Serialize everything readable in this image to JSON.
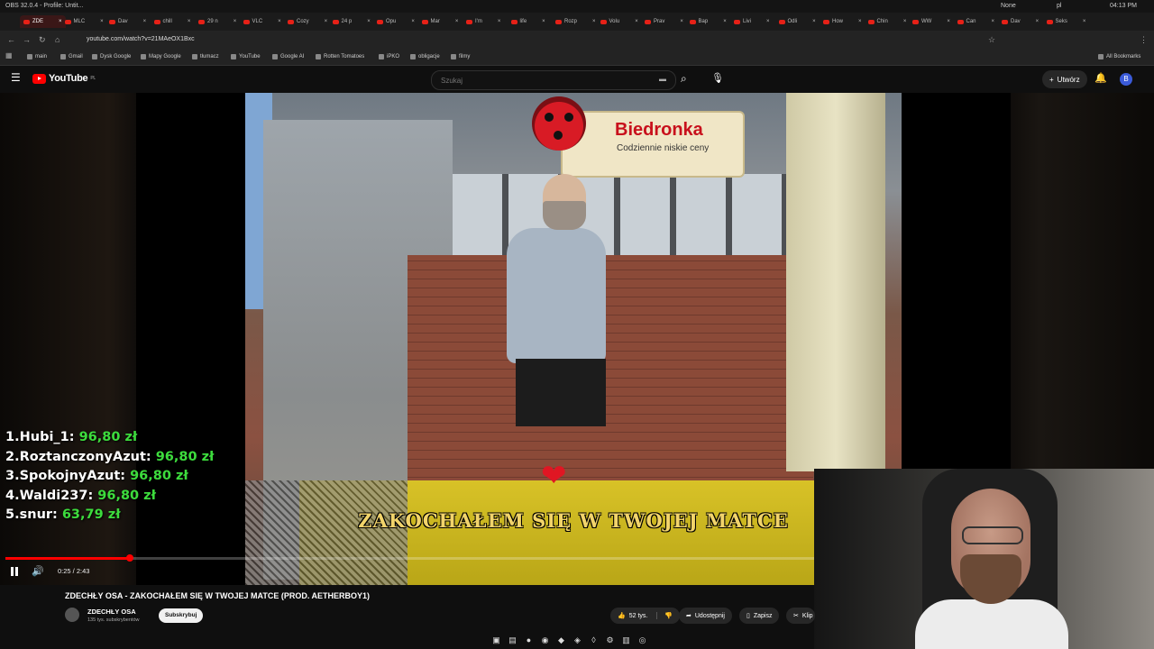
{
  "os_bar": {
    "app": "OBS 32.0.4 - Profile: Untit...",
    "profile": "None",
    "lang": "pl",
    "time": "04:13 PM"
  },
  "browser": {
    "tabs": [
      "ZDE",
      "MLC",
      "Dav",
      "chill",
      "29 n",
      "VLC",
      "Cozy",
      "24 p",
      "Opu",
      "Mar",
      "I'm",
      "life",
      "Rozp",
      "Volu",
      "Prav",
      "Bap",
      "Livi",
      "Odli",
      "How",
      "Chin",
      "WW",
      "Can",
      "Dav",
      "Seks"
    ],
    "url": "youtube.com/watch?v=21MAeOX1Bxc",
    "bookmarks": [
      "main",
      "Gmail",
      "Dysk Google",
      "Mapy Google",
      "tłumacz",
      "YouTube",
      "Google AI",
      "Rotten Tomatoes",
      "iPKO",
      "obligacje",
      "filmy"
    ],
    "all_bookmarks": "All Bookmarks"
  },
  "youtube": {
    "logo_text": "YouTube",
    "logo_region": "PL",
    "search_placeholder": "Szukaj",
    "create_label": "Utwórz",
    "avatar_letter": "B"
  },
  "video": {
    "sign_name": "Biedronka",
    "sign_tagline": "Codziennie niskie ceny",
    "lyric": "ZAKOCHAŁEM SIĘ W TWOJEJ MATCE",
    "heart": "❤",
    "time": "0:25 / 2:43",
    "progress": 0.154
  },
  "donors": [
    {
      "rank": "1.",
      "name": "Hubi_1:",
      "amount": "96,80 zł"
    },
    {
      "rank": "2.",
      "name": "RoztanczonyAzut:",
      "amount": "96,80 zł"
    },
    {
      "rank": "3.",
      "name": "SpokojnyAzut:",
      "amount": "96,80 zł"
    },
    {
      "rank": "4.",
      "name": "Waldi237:",
      "amount": "96,80 zł"
    },
    {
      "rank": "5.",
      "name": "snur:",
      "amount": "63,79 zł"
    }
  ],
  "meta": {
    "title": "ZDECHŁY OSA - ZAKOCHAŁEM SIĘ W TWOJEJ MATCE (PROD. AETHERBOY1)",
    "channel": "ZDECHŁY OSA",
    "subscribers": "135 tys. subskrybentów",
    "subscribe_label": "Subskrybuj",
    "likes": "52 tys.",
    "share_label": "Udostępnij",
    "save_label": "Zapisz",
    "clip_label": "Klip"
  }
}
